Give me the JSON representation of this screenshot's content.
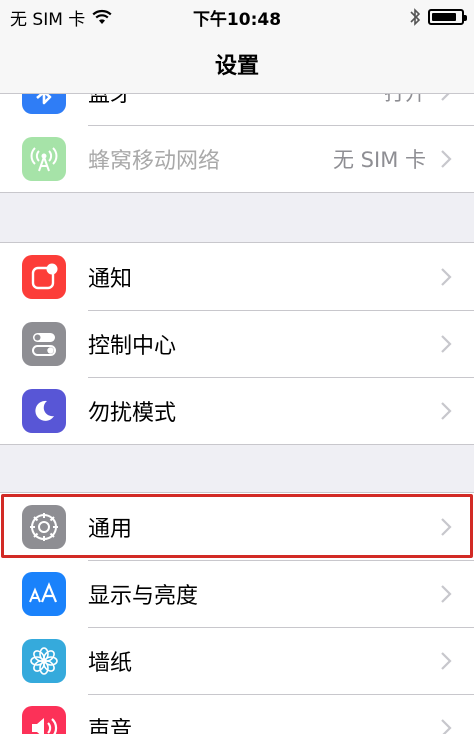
{
  "status_bar": {
    "carrier": "无 SIM 卡",
    "time": "下午10:48",
    "battery_level": 0.85
  },
  "nav": {
    "title": "设置"
  },
  "groups": [
    {
      "items": [
        {
          "label": "蓝牙",
          "detail": "打开",
          "icon": "bluetooth-icon",
          "color": "#2f7df6",
          "partial": true
        },
        {
          "label": "蜂窝移动网络",
          "detail": "无 SIM 卡",
          "icon": "cellular-antenna-icon",
          "color": "#a6e3a8",
          "disabled": true
        }
      ]
    },
    {
      "items": [
        {
          "label": "通知",
          "icon": "notifications-icon",
          "color": "#fc3d39"
        },
        {
          "label": "控制中心",
          "icon": "control-center-icon",
          "color": "#8e8e93"
        },
        {
          "label": "勿扰模式",
          "icon": "moon-icon",
          "color": "#5856d6"
        }
      ]
    },
    {
      "items": [
        {
          "label": "通用",
          "icon": "gear-icon",
          "color": "#8e8e93",
          "highlighted": true
        },
        {
          "label": "显示与亮度",
          "icon": "display-aa-icon",
          "color": "#1a82fb"
        },
        {
          "label": "墙纸",
          "icon": "wallpaper-flower-icon",
          "color": "#35aadc"
        },
        {
          "label": "声音",
          "icon": "speaker-icon",
          "color": "#fc3158",
          "partial": true
        }
      ]
    }
  ],
  "colors": {
    "background": "#efeff4",
    "highlight_border": "#d22a25",
    "separator": "#c8c7cc"
  }
}
